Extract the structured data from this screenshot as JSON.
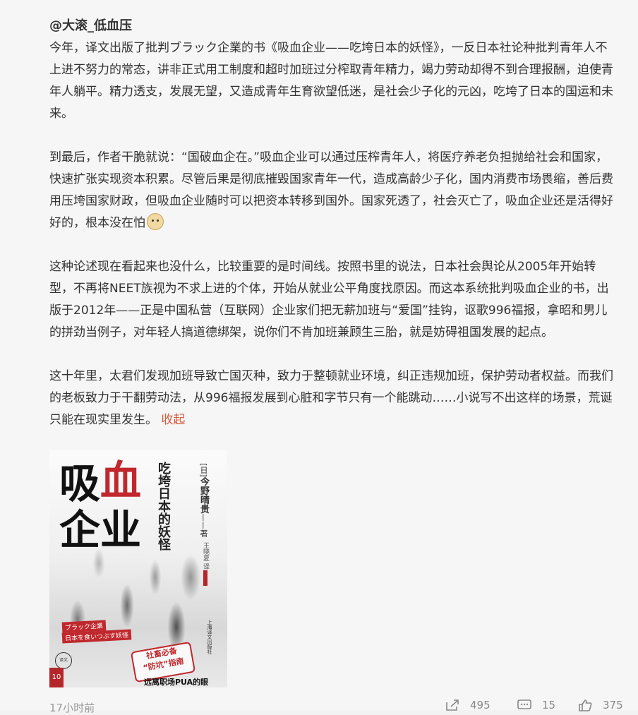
{
  "post": {
    "author": "@大滚_低血压",
    "paragraphs": [
      "今年，译文出版了批判ブラック企業的书《吸血企业——吃垮日本的妖怪》，一反日本社论种批判青年人不上进不努力的常态，讲非正式用工制度和超时加班过分榨取青年精力，竭力劳动却得不到合理报酬，迫使青年人躺平。精力透支，发展无望，又造成青年生育欲望低迷，是社会少子化的元凶，吃垮了日本的国运和未来。",
      "到最后，作者干脆就说：“国破血企在。”吸血企业可以通过压榨青年人，将医疗养老负担抛给社会和国家，快速扩张实现资本积累。尽管后果是彻底摧毁国家青年一代，造成高龄少子化，国内消费市场畏缩，善后费用压垮国家财政，但吸血企业随时可以把资本转移到国外。国家死透了，社会灭亡了，吸血企业还是活得好好的，根本没在怕",
      "这种论述现在看起来也没什么，比较重要的是时间线。按照书里的说法，日本社会舆论从2005年开始转型，不再将NEET族视为不求上进的个体，开始从就业公平角度找原因。而这本系统批判吸血企业的书，出版于2012年——正是中国私营（互联网）企业家们把无薪加班与“爱国”挂钩，讴歌996福报，拿昭和男儿的拼劲当例子，对年轻人搞道德绑架，说你们不肯加班兼顾生三胎，就是妨碍祖国发展的起点。",
      "这十年里，太君们发现加班导致亡国灭种，致力于整顿就业环境，纠正违规加班，保护劳动者权益。而我们的老板致力于干翻劳动法，从996福报发展到心脏和字节只有一个能跳动……小说写不出这样的场景，荒诞只能在现实里发生。"
    ],
    "emoji": "doge",
    "collapse_label": "收起",
    "timestamp": "17小时前",
    "share_count": "495",
    "comment_count": "15",
    "like_count": "375"
  },
  "book_cover": {
    "title_chars": [
      "吸",
      "血",
      "企",
      "业"
    ],
    "subtitle": "吃垮日本的妖怪",
    "author_prefix": "[日]",
    "author_name": "今野晴贵",
    "author_suffix": "——著",
    "translator": "王晓夏 译",
    "publisher": "上海译文出版社",
    "jp_line1": "ブラック企業",
    "jp_line2": "日本を食いつぶす妖怪",
    "stamp_line1": "社畜必备",
    "stamp_line2": "“防坑”指南",
    "publisher_logo": "译文",
    "series_badge": "10",
    "bottom_text": "远离职场PUA的眼"
  },
  "colors": {
    "accent": "#d55b3b",
    "title_red": "#c0282d"
  }
}
